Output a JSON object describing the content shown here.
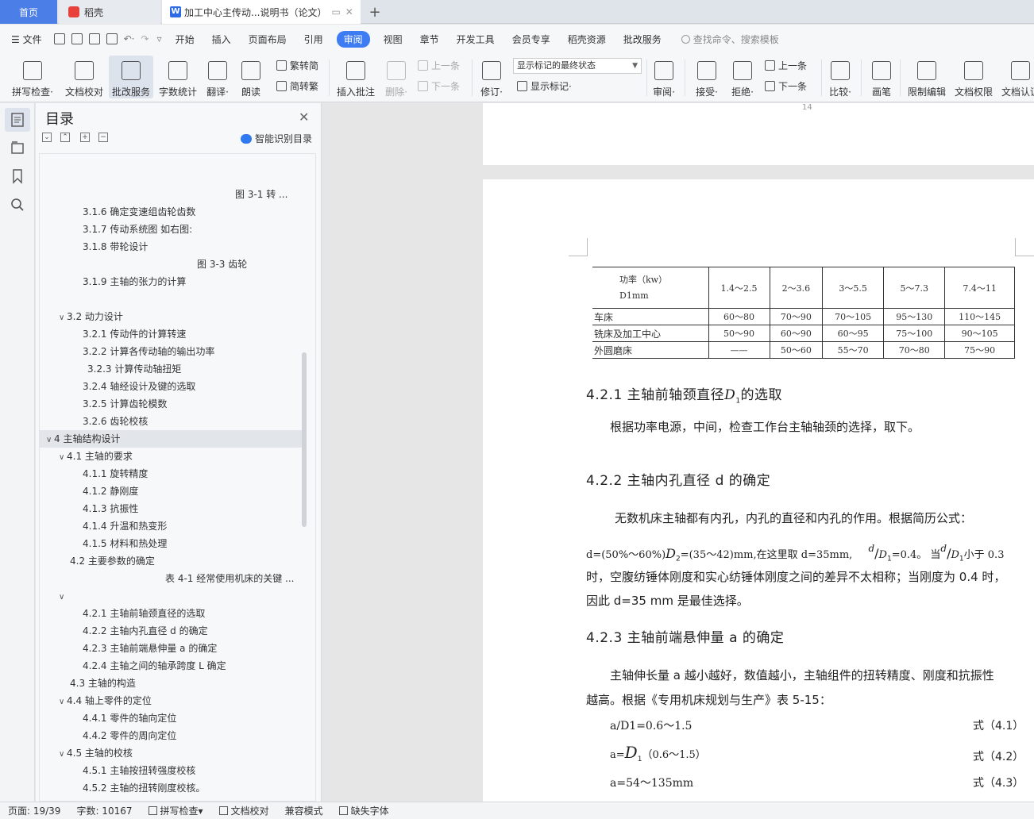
{
  "tabs": {
    "home": "首页",
    "daoke": "稻壳",
    "doc": "加工中心主传动...说明书（论文）",
    "add": "+"
  },
  "menu": {
    "file": "文件",
    "items": [
      "开始",
      "插入",
      "页面布局",
      "引用",
      "审阅",
      "视图",
      "章节",
      "开发工具",
      "会员专享",
      "稻壳资源",
      "批改服务"
    ],
    "active": "审阅",
    "search_placeholder": "查找命令、搜索模板"
  },
  "ribbon": {
    "spell": "拼写检查·",
    "doc_check": "文档校对",
    "correct": "批改服务",
    "word_count": "字数统计",
    "translate": "翻译·",
    "read_aloud": "朗读",
    "trad": "繁转简",
    "simp": "简转繁",
    "insert_comment": "插入批注",
    "delete": "删除·",
    "prev": "上一条",
    "next": "下一条",
    "revise": "修订·",
    "markup_state": "显示标记的最终状态",
    "show_markup": "显示标记·",
    "review": "审阅·",
    "accept": "接受·",
    "reject": "拒绝·",
    "prev2": "上一条",
    "next2": "下一条",
    "compare": "比较·",
    "pen": "画笔",
    "restrict": "限制编辑",
    "doc_rights": "文档权限",
    "doc_cert": "文档认证"
  },
  "toc": {
    "title": "目录",
    "smart": "智能识别目录",
    "items": [
      {
        "text": "图 3-1 转 ...",
        "indent": 240
      },
      {
        "text": "3.1.6  确定变速组齿轮齿数",
        "indent": 48
      },
      {
        "text": "3.1.7  传动系统图  如右图:",
        "indent": 48
      },
      {
        "text": "3.1.8  带轮设计",
        "indent": 48
      },
      {
        "text": "图 3-3 齿轮",
        "indent": 192
      },
      {
        "text": "3.1.9  主轴的张力的计算",
        "indent": 48
      },
      {
        "text": "",
        "indent": 48
      },
      {
        "text": "3.2    动力设计",
        "indent": 18,
        "caret": "v"
      },
      {
        "text": "3.2.1  传动件的计算转速",
        "indent": 48
      },
      {
        "text": "3.2.2  计算各传动轴的输出功率",
        "indent": 48
      },
      {
        "text": "3.2.3  计算传动轴扭矩",
        "indent": 54
      },
      {
        "text": "3.2.4  轴经设计及键的选取",
        "indent": 48
      },
      {
        "text": "3.2.5  计算齿轮模数",
        "indent": 48
      },
      {
        "text": "3.2.6  齿轮校核",
        "indent": 48
      },
      {
        "text": "4 主轴结构设计",
        "indent": 2,
        "caret": "v",
        "hl": true
      },
      {
        "text": "4.1  主轴的要求",
        "indent": 18,
        "caret": "v"
      },
      {
        "text": "4.1.1  旋转精度",
        "indent": 48
      },
      {
        "text": "4.1.2  静刚度",
        "indent": 48
      },
      {
        "text": "4.1.3  抗振性",
        "indent": 48
      },
      {
        "text": "4.1.4  升温和热变形",
        "indent": 48
      },
      {
        "text": "4.1.5  材料和热处理",
        "indent": 48
      },
      {
        "text": "4.2  主要参数的确定",
        "indent": 32
      },
      {
        "text": "表 4-1 经常使用机床的关键 ...",
        "indent": 152
      },
      {
        "text": "",
        "indent": 18,
        "caret": "v"
      },
      {
        "text": "4.2.1  主轴前轴颈直径的选取",
        "indent": 48
      },
      {
        "text": "4.2.2  主轴内孔直径 d 的确定",
        "indent": 48
      },
      {
        "text": "4.2.3 主轴前端悬伸量 a 的确定",
        "indent": 48
      },
      {
        "text": "4.2.4  主轴之间的轴承跨度 L 确定",
        "indent": 48
      },
      {
        "text": "4.3    主轴的构造",
        "indent": 32
      },
      {
        "text": "4.4    轴上零件的定位",
        "indent": 18,
        "caret": "v"
      },
      {
        "text": "4.4.1 零件的轴向定位",
        "indent": 48
      },
      {
        "text": "4.4.2 零件的周向定位",
        "indent": 48
      },
      {
        "text": "4.5    主轴的校核",
        "indent": 18,
        "caret": "v"
      },
      {
        "text": "4.5.1 主轴按扭转强度校核",
        "indent": 48
      },
      {
        "text": "4.5.2 主轴的扭转刚度校核。",
        "indent": 48
      }
    ]
  },
  "doc": {
    "prev_page_num": "14",
    "table": {
      "head_label_1": "功率（kw）",
      "head_label_2": "D1mm",
      "cols": [
        "1.4～2.5",
        "2～3.6",
        "3～5.5",
        "5～7.3",
        "7.4～11"
      ],
      "rows": [
        {
          "label": "车床",
          "vals": [
            "60～80",
            "70～90",
            "70～105",
            "95～130",
            "110～145"
          ]
        },
        {
          "label": "铣床及加工中心",
          "vals": [
            "50～90",
            "60～90",
            "60～95",
            "75～100",
            "90～105"
          ]
        },
        {
          "label": "外圆磨床",
          "vals": [
            "——",
            "50～60",
            "55～70",
            "70～80",
            "75～90"
          ]
        }
      ]
    },
    "h421_pre": "4.2.1  主轴前轴颈直径",
    "h421_sym": "D",
    "h421_sub": "1",
    "h421_post": "的选取",
    "p1": "根据功率电源，中间，检查工作台主轴轴颈的选择，取下。",
    "h422": "4.2.2  主轴内孔直径 d 的确定",
    "p2": "无数机床主轴都有内孔，内孔的直径和内孔的作用。根据简历公式：",
    "f_line1_a": "d=(50%～60%)",
    "f_line1_sym": "D",
    "f_line1_sub": "2",
    "f_line1_b": "=(35～42)mm,在这里取 d=35mm,",
    "f_line1_frac_top": "d",
    "f_line1_frac_bot": "D",
    "f_line1_frac_sub": "1",
    "f_line1_c": "=0.4。  当",
    "f_line1_d": "小于 0.3",
    "p3": "时，空腹纺锤体刚度和实心纺锤体刚度之间的差异不太相称；当刚度为 0.4 时，",
    "p4": "因此 d=35 mm 是最佳选择。",
    "h423": "4.2.3 主轴前端悬伸量 a 的确定",
    "p5": "主轴伸长量 a 越小越好，数值越小，主轴组件的扭转精度、刚度和抗振性",
    "p6": "越高。根据《专用机床规划与生产》表 5-15：",
    "eq1": "a/D1=0.6～1.5",
    "eq1_no": "式（4.1）",
    "eq2_a": "a=",
    "eq2_sym": "D",
    "eq2_sub": "1",
    "eq2_b": "（0.6～1.5）",
    "eq2_no": "式（4.2）",
    "eq3": "a=54～135mm",
    "eq3_no": "式（4.3）"
  },
  "status": {
    "page": "页面: 19/39",
    "words": "字数: 10167",
    "spell": "拼写检查",
    "check": "文档校对",
    "compat": "兼容模式",
    "missing_font": "缺失字体"
  }
}
